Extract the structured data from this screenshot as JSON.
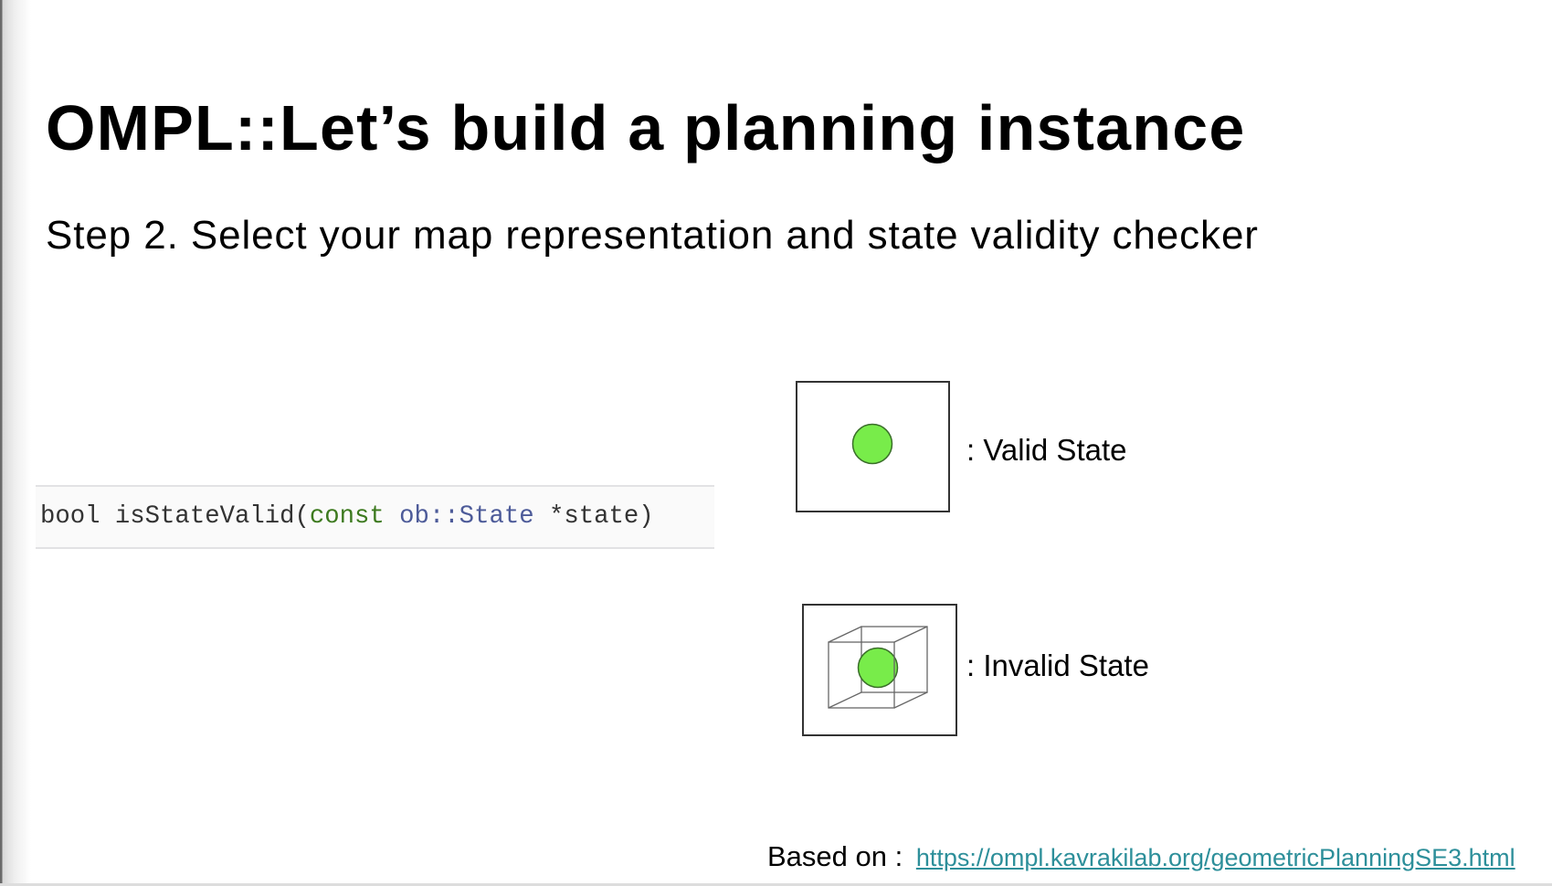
{
  "slide": {
    "title": "OMPL::Let’s build a planning instance",
    "subtitle": "Step 2. Select your map representation and state validity checker"
  },
  "code": {
    "return_type": "bool",
    "function_name": " isStateValid(",
    "const_keyword": "const",
    "param_type": " ob::State",
    "param_name": " *state)"
  },
  "legend": {
    "valid_label": ": Valid State",
    "invalid_label": ": Invalid State"
  },
  "footer": {
    "prefix": "Based on :",
    "link": "https://ompl.kavrakilab.org/geometricPlanningSE3.html"
  },
  "colors": {
    "state_fill": "#78ec4a",
    "link": "#2d8f9a"
  }
}
